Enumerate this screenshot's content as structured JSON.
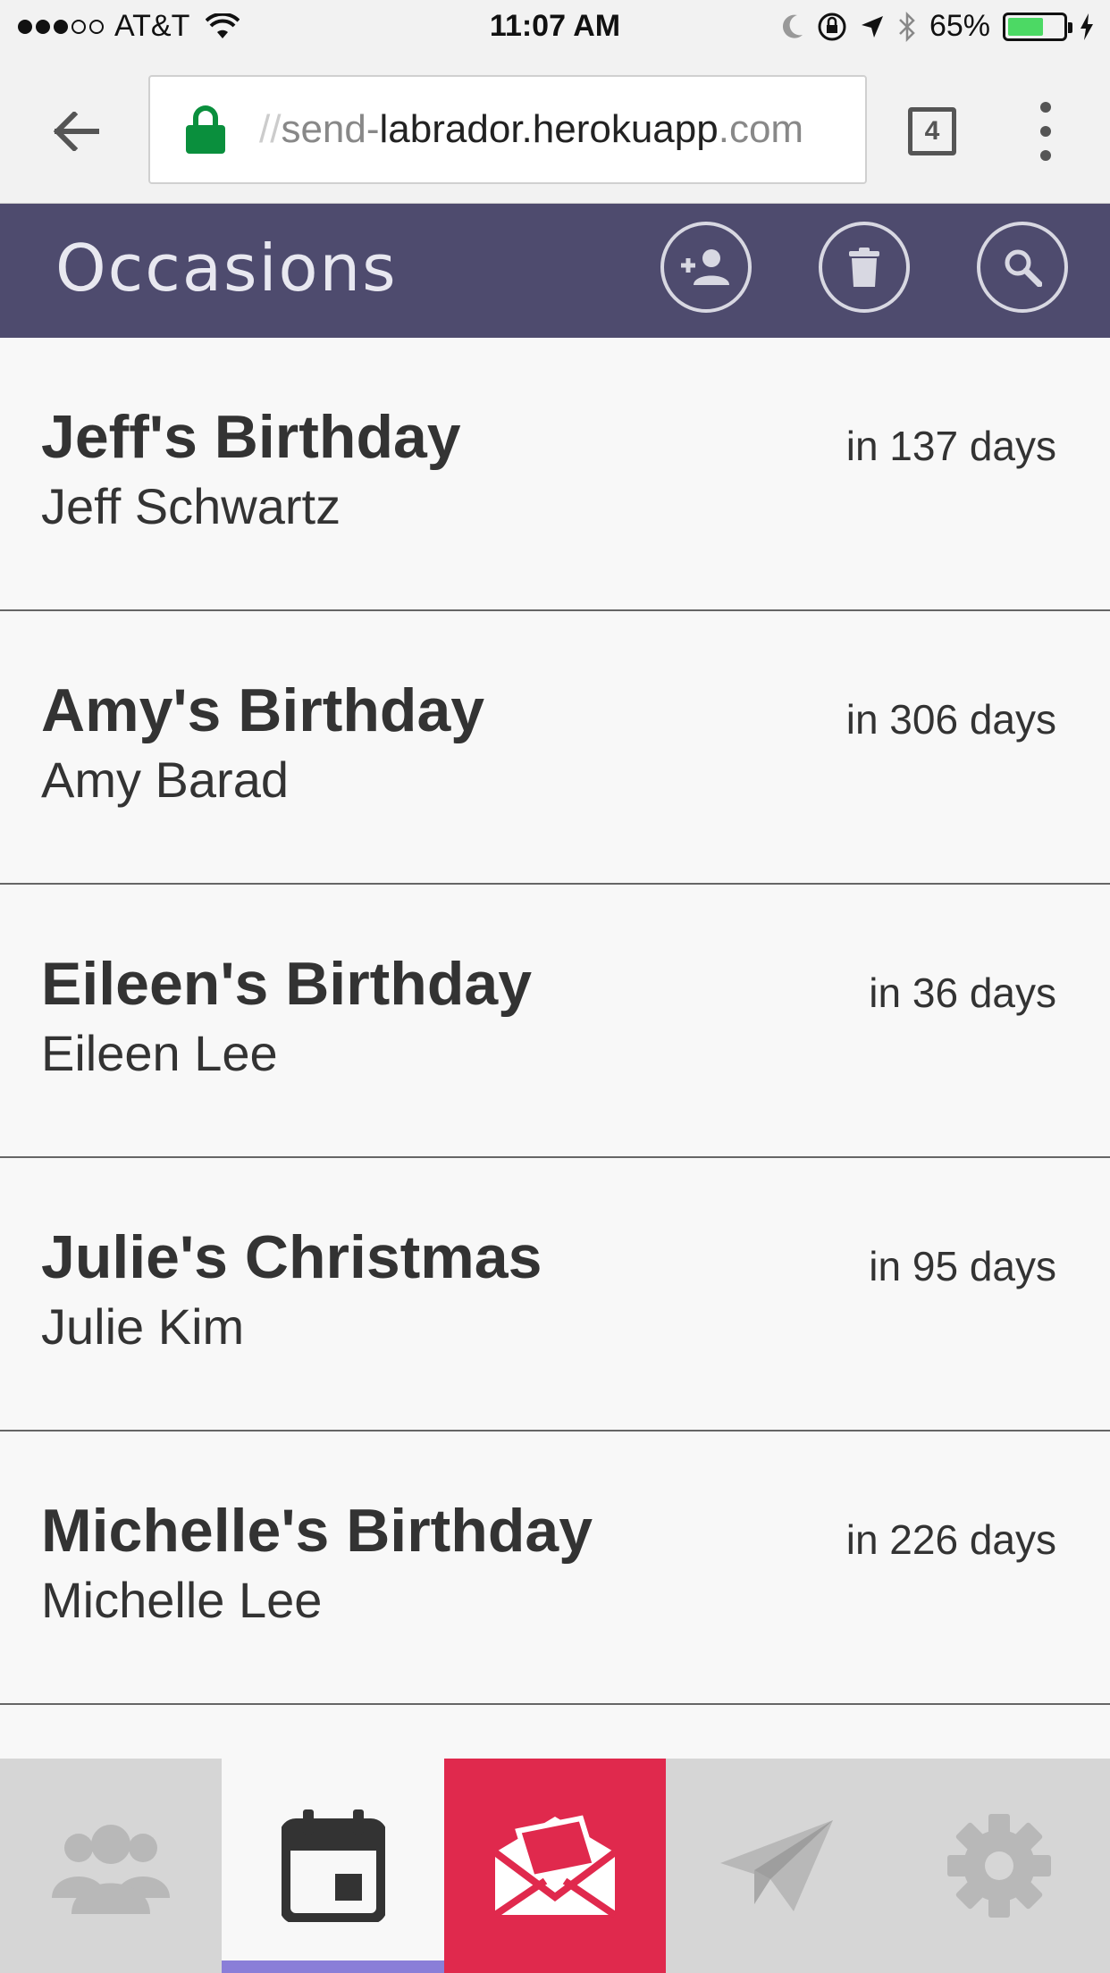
{
  "status_bar": {
    "carrier": "AT&T",
    "time": "11:07 AM",
    "battery": "65%",
    "battery_level": 0.65
  },
  "browser": {
    "url_scheme": "//",
    "url_sub": "send-",
    "url_host": "labrador.herokuapp",
    "url_tld": ".com",
    "tab_count": "4"
  },
  "header": {
    "title": "Occasions",
    "buttons": [
      "add-person-icon",
      "trash-icon",
      "search-icon"
    ]
  },
  "occasions": [
    {
      "title": "Jeff's Birthday",
      "person": "Jeff Schwartz",
      "days": "in 137 days"
    },
    {
      "title": "Amy's Birthday",
      "person": "Amy Barad",
      "days": "in 306 days"
    },
    {
      "title": "Eileen's Birthday",
      "person": "Eileen Lee",
      "days": "in 36 days"
    },
    {
      "title": "Julie's Christmas",
      "person": "Julie Kim",
      "days": "in 95 days"
    },
    {
      "title": "Michelle's Birthday",
      "person": "Michelle Lee",
      "days": "in 226 days"
    }
  ],
  "bottom_nav": {
    "items": [
      "people-icon",
      "calendar-icon",
      "envelope-icon",
      "paper-plane-icon",
      "gear-icon"
    ],
    "active": "calendar-icon",
    "colors": {
      "active_indicator": "#8a7ed8",
      "compose": "#e0294d",
      "header": "#4e4b6e"
    }
  }
}
